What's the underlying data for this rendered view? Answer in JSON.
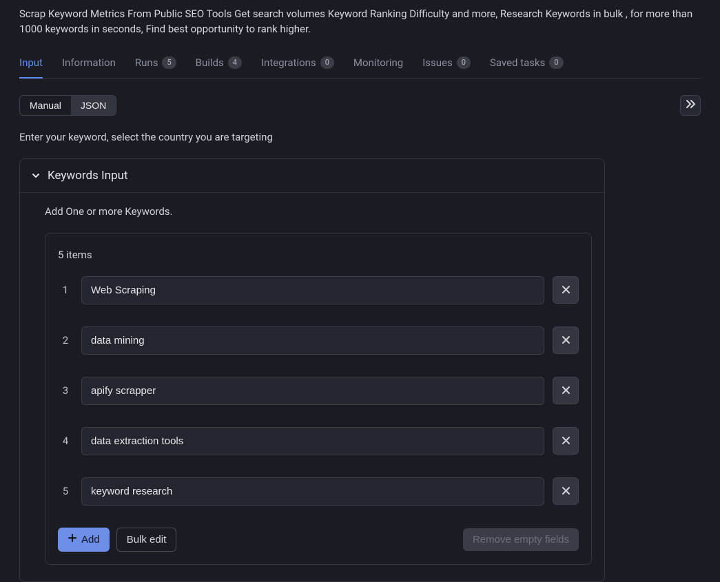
{
  "description": "Scrap Keyword Metrics From Public SEO Tools Get search volumes Keyword Ranking Difficulty and more, Research Keywords in bulk , for more than 1000 keywords in seconds, Find best opportunity to rank higher.",
  "tabs": [
    {
      "label": "Input",
      "active": true
    },
    {
      "label": "Information"
    },
    {
      "label": "Runs",
      "badge": "5"
    },
    {
      "label": "Builds",
      "badge": "4"
    },
    {
      "label": "Integrations",
      "badge": "0"
    },
    {
      "label": "Monitoring"
    },
    {
      "label": "Issues",
      "badge": "0"
    },
    {
      "label": "Saved tasks",
      "badge": "0"
    }
  ],
  "mode": {
    "manual": "Manual",
    "json": "JSON"
  },
  "instruction": "Enter your keyword, select the country you are targeting",
  "section": {
    "title": "Keywords Input",
    "help": "Add One or more Keywords.",
    "count_label": "5 items",
    "items": [
      {
        "num": "1",
        "value": "Web Scraping"
      },
      {
        "num": "2",
        "value": "data mining"
      },
      {
        "num": "3",
        "value": "apify scrapper"
      },
      {
        "num": "4",
        "value": "data extraction tools"
      },
      {
        "num": "5",
        "value": "keyword research"
      }
    ],
    "add_label": "Add",
    "bulk_label": "Bulk edit",
    "remove_empty_label": "Remove empty fields"
  }
}
